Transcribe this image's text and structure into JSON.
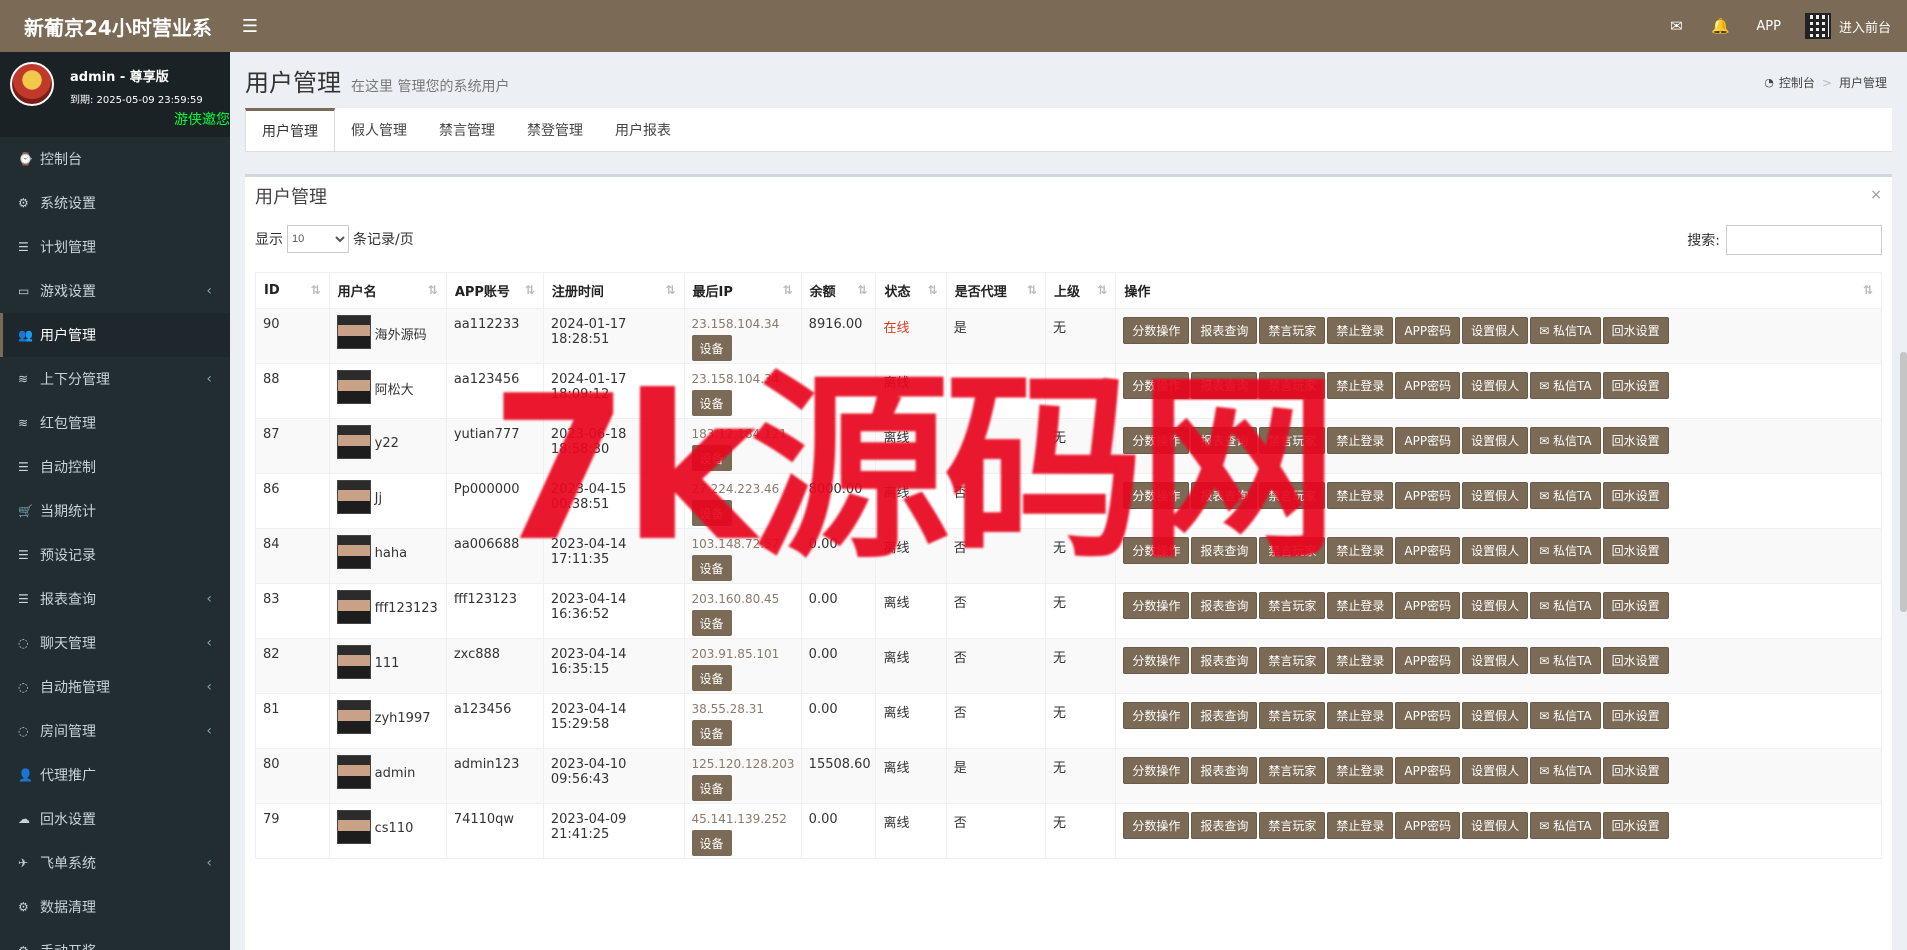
{
  "header": {
    "brand": "新葡京24小时营业系",
    "menu_icon": "☰",
    "mail_icon": "✉",
    "bell_icon": "🔔",
    "app_label": "APP",
    "enter_label": "进入前台"
  },
  "sidebar": {
    "user_name": "admin - 尊享版",
    "expire": "到期: 2025-05-09 23:59:59",
    "marquee": "游侠邀您",
    "items": [
      {
        "label": "控制台",
        "icon": "⌚",
        "caret": ""
      },
      {
        "label": "系统设置",
        "icon": "⚙",
        "caret": ""
      },
      {
        "label": "计划管理",
        "icon": "☰",
        "caret": ""
      },
      {
        "label": "游戏设置",
        "icon": "▭",
        "caret": "‹"
      },
      {
        "label": "用户管理",
        "icon": "👥",
        "caret": ""
      },
      {
        "label": "上下分管理",
        "icon": "≋",
        "caret": "‹"
      },
      {
        "label": "红包管理",
        "icon": "≋",
        "caret": ""
      },
      {
        "label": "自动控制",
        "icon": "☰",
        "caret": ""
      },
      {
        "label": "当期统计",
        "icon": "🛒",
        "caret": ""
      },
      {
        "label": "预设记录",
        "icon": "☰",
        "caret": ""
      },
      {
        "label": "报表查询",
        "icon": "☰",
        "caret": "‹"
      },
      {
        "label": "聊天管理",
        "icon": "◌",
        "caret": "‹"
      },
      {
        "label": "自动拖管理",
        "icon": "◌",
        "caret": "‹"
      },
      {
        "label": "房间管理",
        "icon": "◌",
        "caret": "‹"
      },
      {
        "label": "代理推广",
        "icon": "👤",
        "caret": ""
      },
      {
        "label": "回水设置",
        "icon": "☁",
        "caret": ""
      },
      {
        "label": "飞单系统",
        "icon": "✈",
        "caret": "‹"
      },
      {
        "label": "数据清理",
        "icon": "⚙",
        "caret": ""
      },
      {
        "label": "手动开奖",
        "icon": "⚙",
        "caret": ""
      }
    ]
  },
  "page": {
    "title": "用户管理",
    "subtitle": "在这里 管理您的系统用户",
    "breadcrumb_home": "控制台",
    "breadcrumb_sep": ">",
    "breadcrumb_current": "用户管理",
    "tabs": [
      "用户管理",
      "假人管理",
      "禁言管理",
      "禁登管理",
      "用户报表"
    ]
  },
  "box": {
    "title": "用户管理",
    "close": "×",
    "show_label": "显示",
    "page_size": "10",
    "per_page_label": "条记录/页",
    "search_label": "搜索:"
  },
  "table": {
    "columns": [
      "ID",
      "用户名",
      "APP账号",
      "注册时间",
      "最后IP",
      "余额",
      "状态",
      "是否代理",
      "上级",
      "操作"
    ],
    "device_label": "设备",
    "op_buttons": [
      "分数操作",
      "报表查询",
      "禁言玩家",
      "禁止登录",
      "APP密码",
      "设置假人",
      "私信TA",
      "回水设置"
    ],
    "rows": [
      {
        "id": "90",
        "name": "海外源码",
        "app": "aa112233",
        "reg": "2024-01-17 18:28:51",
        "ip": "23.158.104.34",
        "balance": "8916.00",
        "status": "在线",
        "agent": "是",
        "parent": "无"
      },
      {
        "id": "88",
        "name": "阿松大",
        "app": "aa123456",
        "reg": "2024-01-17 18:09:12",
        "ip": "23.158.104.34",
        "balance": "",
        "status": "离线",
        "agent": "",
        "parent": ""
      },
      {
        "id": "87",
        "name": "y22",
        "app": "yutian777",
        "reg": "2023-06-18 18:58:30",
        "ip": "183.12.184.121",
        "balance": "",
        "status": "离线",
        "agent": "",
        "parent": "无"
      },
      {
        "id": "86",
        "name": "Jj",
        "app": "Pp000000",
        "reg": "2023-04-15 00:38:51",
        "ip": "27.224.223.46",
        "balance": "8000.00",
        "status": "离线",
        "agent": "否",
        "parent": ""
      },
      {
        "id": "84",
        "name": "haha",
        "app": "aa006688",
        "reg": "2023-04-14 17:11:35",
        "ip": "103.148.72.57",
        "balance": "0.00",
        "status": "离线",
        "agent": "否",
        "parent": "无"
      },
      {
        "id": "83",
        "name": "fff123123",
        "app": "fff123123",
        "reg": "2023-04-14 16:36:52",
        "ip": "203.160.80.45",
        "balance": "0.00",
        "status": "离线",
        "agent": "否",
        "parent": "无"
      },
      {
        "id": "82",
        "name": "111",
        "app": "zxc888",
        "reg": "2023-04-14 16:35:15",
        "ip": "203.91.85.101",
        "balance": "0.00",
        "status": "离线",
        "agent": "否",
        "parent": "无"
      },
      {
        "id": "81",
        "name": "zyh1997",
        "app": "a123456",
        "reg": "2023-04-14 15:29:58",
        "ip": "38.55.28.31",
        "balance": "0.00",
        "status": "离线",
        "agent": "否",
        "parent": "无"
      },
      {
        "id": "80",
        "name": "admin",
        "app": "admin123",
        "reg": "2023-04-10 09:56:43",
        "ip": "125.120.128.203",
        "balance": "15508.60",
        "status": "离线",
        "agent": "是",
        "parent": "无"
      },
      {
        "id": "79",
        "name": "cs110",
        "app": "74110qw",
        "reg": "2023-04-09 21:41:25",
        "ip": "45.141.139.252",
        "balance": "0.00",
        "status": "离线",
        "agent": "否",
        "parent": "无"
      }
    ]
  },
  "watermark": "7k源码网",
  "colors": {
    "accent": "#7b6a55",
    "sidebar": "#222d32",
    "online": "#dd3a1e",
    "marquee": "#00ff3a"
  }
}
